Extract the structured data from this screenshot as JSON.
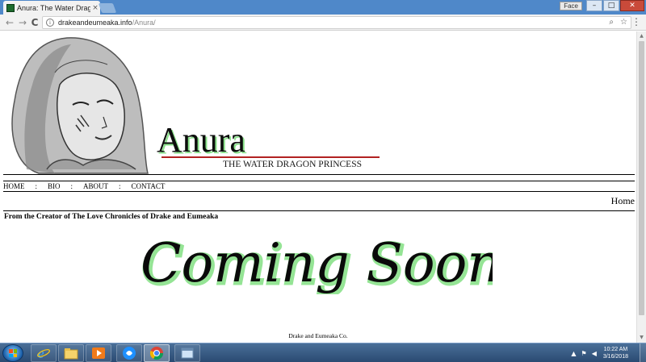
{
  "browser": {
    "tab_title": "Anura: The Water Dragon",
    "tab_close": "×",
    "profile_label": "Face",
    "url_host": "drakeandeumeaka.info",
    "url_path": "/Anura/",
    "back_glyph": "←",
    "forward_glyph": "→",
    "reload_glyph": "C",
    "info_glyph": "i",
    "zoom_glyph": "⌕",
    "star_glyph": "☆",
    "menu_glyph": "⋮",
    "minimize_glyph": "–",
    "maximize_glyph": "□",
    "close_glyph": "✕"
  },
  "page": {
    "banner": {
      "title": "Anura",
      "subtitle": "THE WATER DRAGON PRINCESS"
    },
    "nav": {
      "items": [
        "HOME",
        "BIO",
        "ABOUT",
        "CONTACT"
      ],
      "separator": ":"
    },
    "breadcrumb": "Home",
    "tagline": "From the Creator of The Love Chronicles of Drake and Eumeaka",
    "coming_soon": "Coming Soon",
    "footer": "Drake and Eumeaka Co.",
    "colors": {
      "accent_green": "#3fcf3f",
      "title_red_rule": "#b22222"
    }
  },
  "taskbar": {
    "time": "10:22 AM",
    "date": "3/16/2018",
    "icons": [
      "windows-start-icon",
      "internet-explorer-icon",
      "file-explorer-icon",
      "media-player-icon",
      "app-icon",
      "chrome-icon",
      "window-icon"
    ]
  }
}
